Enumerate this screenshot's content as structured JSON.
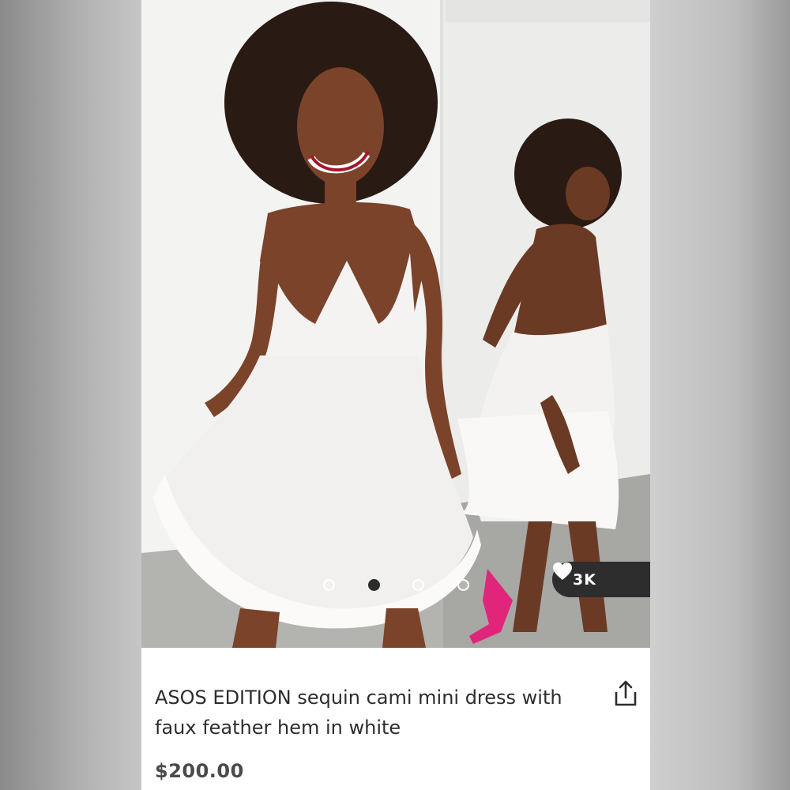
{
  "product": {
    "title": "ASOS EDITION sequin cami mini dress with faux feather hem in white",
    "price": "$200.00",
    "saves_count": "3K"
  },
  "carousel": {
    "total_images": 4,
    "active_index": 1
  },
  "icons": {
    "save": "heart-icon",
    "share": "share-icon"
  },
  "colors": {
    "pill_background": "#2d2d2d",
    "text": "#2d2d2d",
    "price": "#4a4a4a",
    "shoe_accent": "#e0257a"
  }
}
